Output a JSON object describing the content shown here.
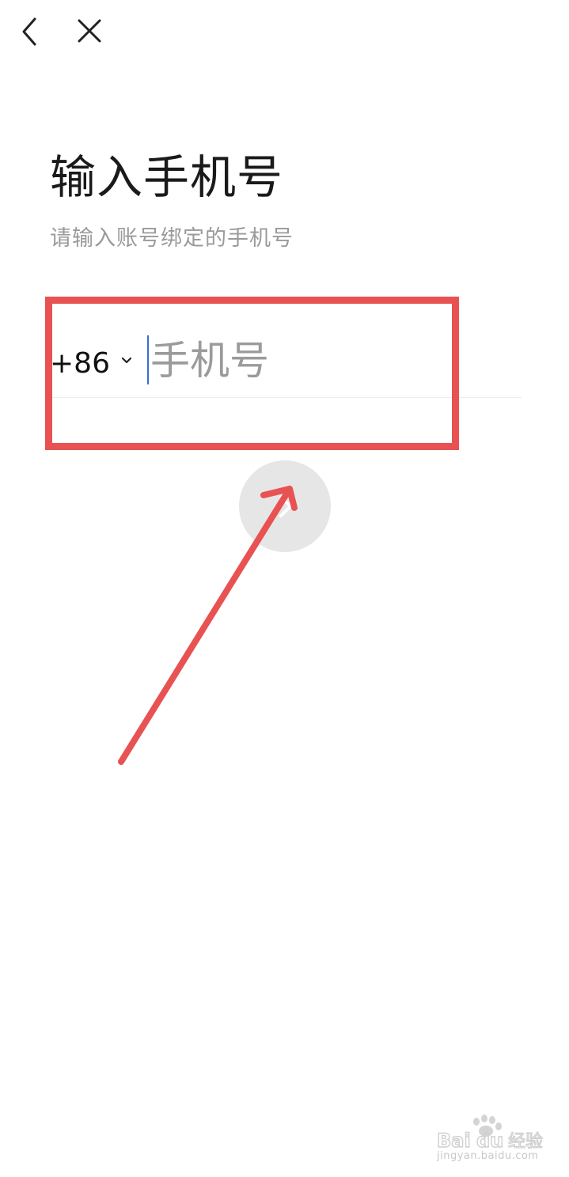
{
  "nav": {
    "back_icon": "chevron-left-icon",
    "close_icon": "close-icon"
  },
  "page": {
    "title": "输入手机号",
    "subtitle": "请输入账号绑定的手机号"
  },
  "phone_form": {
    "country_code": "+86",
    "country_code_icon": "chevron-down-icon",
    "input_value": "",
    "input_placeholder": "手机号"
  },
  "next_button": {
    "icon": "chevron-right-icon"
  },
  "annotation": {
    "color": "#e85252"
  },
  "watermark": {
    "logo_text": "Baidu 经验",
    "url": "jingyan.baidu.com"
  }
}
